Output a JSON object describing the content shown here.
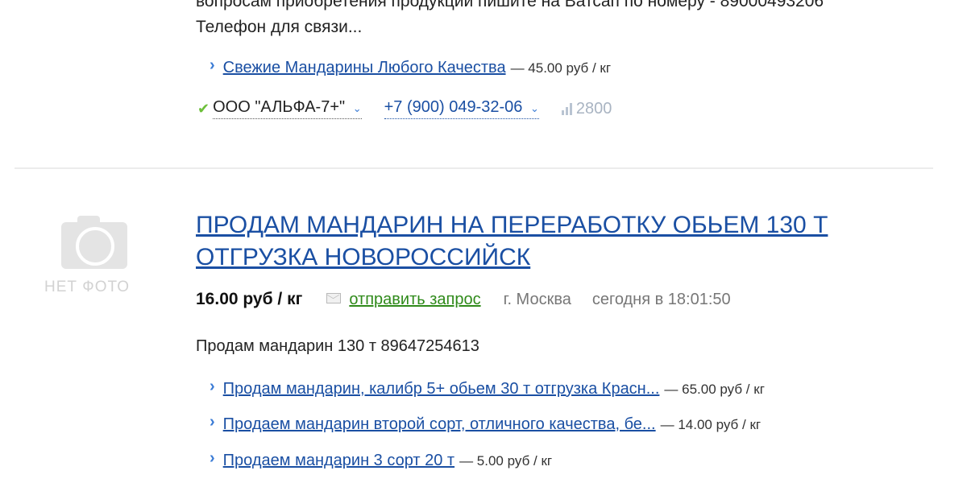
{
  "prev_listing": {
    "desc_line1": "вопросам приобретения продукции пишите на Ватсап по номеру - 89000493206",
    "desc_line2": "Телефон для связи...",
    "related": {
      "title": "Свежие Мандарины Любого Качества",
      "price": "— 45.00 руб / кг"
    },
    "seller": {
      "company": "ООО \"АЛЬФА-7+\"",
      "phone": "+7 (900) 049-32-06",
      "views": "2800"
    }
  },
  "listing": {
    "no_photo_label": "НЕТ ФОТО",
    "title_line1": "ПРОДАМ МАНДАРИН НА ПЕРЕРАБОТКУ ОБЬЕМ 130 Т",
    "title_line2": "ОТГРУЗКА НОВОРОССИЙСК",
    "price": "16.00 руб / кг",
    "request_link": "отправить запрос",
    "city": "г. Москва",
    "time": "сегодня в 18:01:50",
    "description": "Продам мандарин 130 т 89647254613",
    "related": [
      {
        "title": "Продам мандарин, калибр 5+ обьем 30 т отгрузка Красн...",
        "price": "— 65.00 руб / кг"
      },
      {
        "title": "Продаем мандарин второй сорт, отличного качества, бе...",
        "price": "— 14.00 руб / кг"
      },
      {
        "title": "Продаем мандарин 3 сорт 20 т",
        "price": "— 5.00 руб / кг"
      }
    ]
  },
  "icons": {
    "chevron": "chevron-right-icon",
    "check": "checkmark-icon",
    "caret": "chevron-down-icon",
    "stats": "bar-chart-icon",
    "envelope": "envelope-icon",
    "camera": "camera-icon"
  },
  "colors": {
    "link": "#1a4fa3",
    "request_link": "#2f8a1a",
    "check": "#6cbf3a",
    "muted": "#777777"
  }
}
